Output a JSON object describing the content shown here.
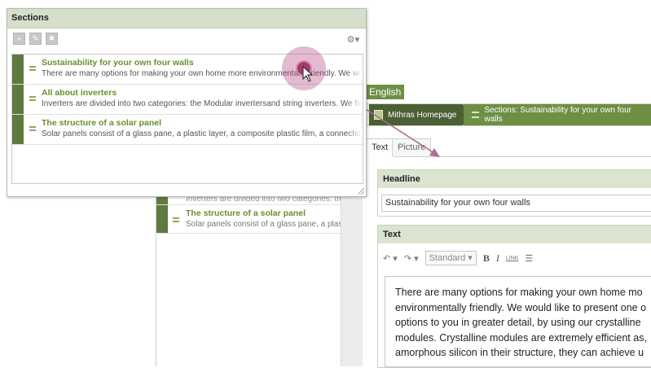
{
  "sections_window": {
    "title": "Sections",
    "items": [
      {
        "title": "Sustainability for your own four walls",
        "desc": "There are many options for making your own home more environmentally friendly. We wou"
      },
      {
        "title": "All about inverters",
        "desc": "Inverters are divided into two categories: the Modular invertersand string inverters. We ha"
      },
      {
        "title": "The structure of a solar panel",
        "desc": "Solar panels consist of a glass pane, a plastic layer, a composite plastic film, a connection"
      }
    ]
  },
  "background_list": {
    "items": [
      {
        "title": "",
        "desc": "Inverters are divided into two categories: th"
      },
      {
        "title": "The structure of a solar panel",
        "desc": "Solar panels consist of a glass pane, a plas"
      }
    ]
  },
  "editor": {
    "language": "English",
    "breadcrumb": {
      "home": "Mithras Homepage",
      "section": "Sections: Sustainability for your own four walls"
    },
    "tabs": [
      "Text",
      "Picture"
    ],
    "headline": {
      "label": "Headline",
      "value": "Sustainability for your own four walls"
    },
    "text": {
      "label": "Text",
      "style_select": "Standard",
      "lines": [
        "There are many options for making your own home mo",
        "environmentally friendly. We would like to present one o",
        "options to you in greater detail, by using our crystalline",
        "modules. Crystalline modules are extremely efficient as,",
        "amorphous silicon in their structure, they can achieve u"
      ]
    }
  },
  "colors": {
    "accent_green": "#6f8f45",
    "bar_green": "#5f7a3f",
    "cursor_highlight": "#a43a70"
  }
}
